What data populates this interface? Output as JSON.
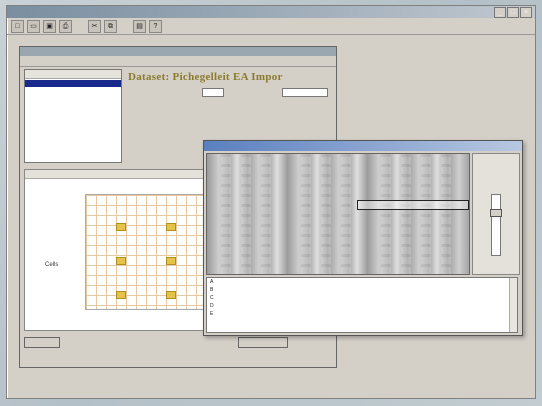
{
  "window": {
    "title": "",
    "controls": [
      "_",
      "□",
      "×"
    ]
  },
  "toolbar": {
    "buttons": [
      "new",
      "open",
      "save",
      "print",
      "cut",
      "copy",
      "paste",
      "help"
    ]
  },
  "child": {
    "tab": "",
    "list_header": "",
    "heading": "Dataset: Pichegelleit EA Impor",
    "fields_left": [
      "",
      "",
      "",
      "",
      "",
      "",
      ""
    ],
    "fields_right": [
      "",
      "",
      "",
      ""
    ],
    "button_left": "",
    "button_right": "",
    "status_text": ""
  },
  "plate": {
    "y_label": "Cells",
    "x_label": ""
  },
  "gel": {
    "title": "",
    "table_rows": [
      [
        "A",
        "",
        "",
        "",
        "",
        "",
        "",
        "",
        "",
        "",
        "",
        "",
        "",
        ""
      ],
      [
        "B",
        "",
        "",
        "",
        "",
        "",
        "",
        "",
        "",
        "",
        "",
        "",
        "",
        ""
      ],
      [
        "C",
        "",
        "",
        "",
        "",
        "",
        "",
        "",
        "",
        "",
        "",
        "",
        "",
        ""
      ],
      [
        "D",
        "",
        "",
        "",
        "",
        "",
        "",
        "",
        "",
        "",
        "",
        "",
        "",
        ""
      ],
      [
        "E",
        "",
        "",
        "",
        "",
        "",
        "",
        "",
        "",
        "",
        "",
        "",
        "",
        ""
      ]
    ],
    "status": ""
  }
}
